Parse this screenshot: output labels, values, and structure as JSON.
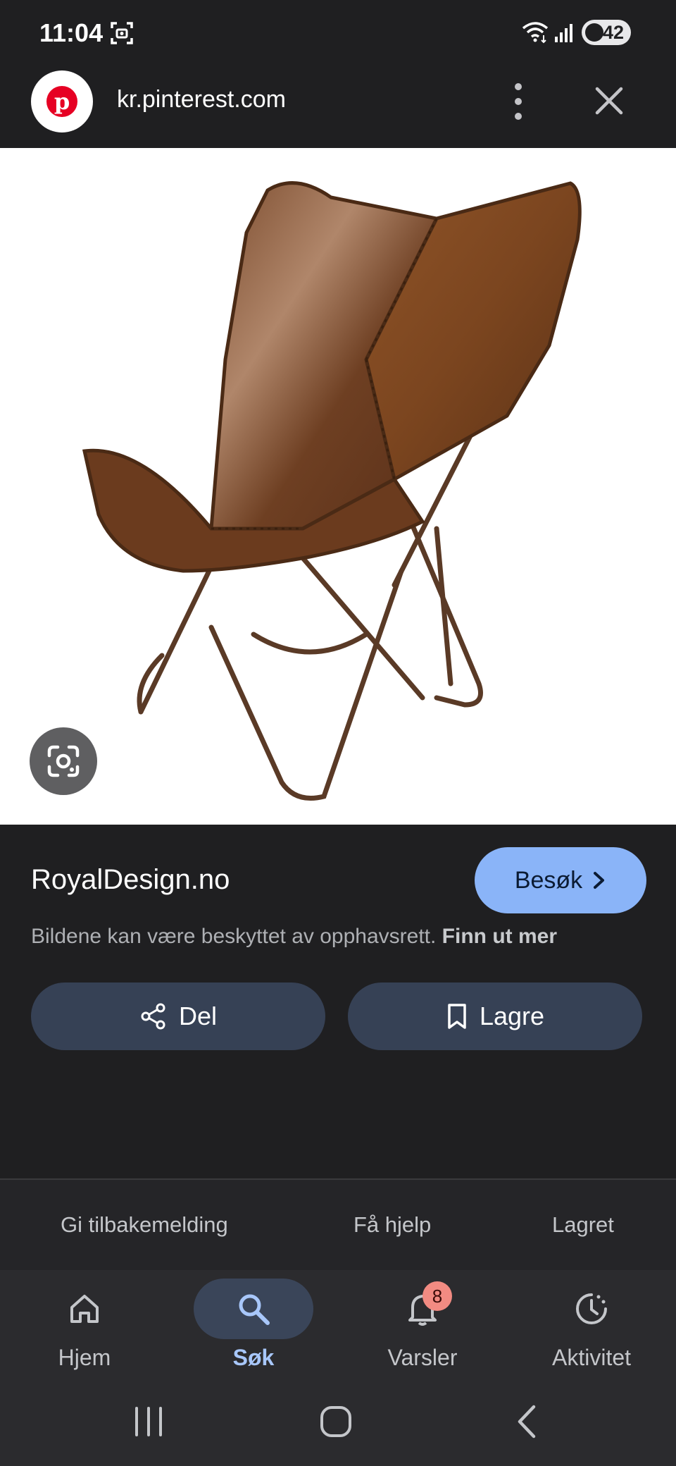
{
  "status_bar": {
    "time": "11:04",
    "battery": "42"
  },
  "browser": {
    "url": "kr.pinterest.com",
    "site_icon": "pinterest-logo",
    "site_icon_letter": "p"
  },
  "image": {
    "subject_icon": "butterfly-chair",
    "lens_icon": "google-lens-icon"
  },
  "info": {
    "source_name": "RoyalDesign.no",
    "visit_label": "Besøk",
    "copyright_text": "Bildene kan være beskyttet av opphavsrett.",
    "learn_more_label": "Finn ut mer",
    "share_label": "Del",
    "save_label": "Lagre"
  },
  "footer_links": [
    {
      "label": "Gi tilbakemelding"
    },
    {
      "label": "Få hjelp"
    },
    {
      "label": "Lagret"
    }
  ],
  "bottom_nav": {
    "items": [
      {
        "label": "Hjem",
        "icon": "home-icon"
      },
      {
        "label": "Søk",
        "icon": "search-icon",
        "active": true
      },
      {
        "label": "Varsler",
        "icon": "bell-icon",
        "badge": "8"
      },
      {
        "label": "Aktivitet",
        "icon": "activity-icon"
      }
    ]
  },
  "colors": {
    "background": "#1f1f21",
    "accent": "#8ab4f8",
    "pinterest_red": "#e60023"
  }
}
